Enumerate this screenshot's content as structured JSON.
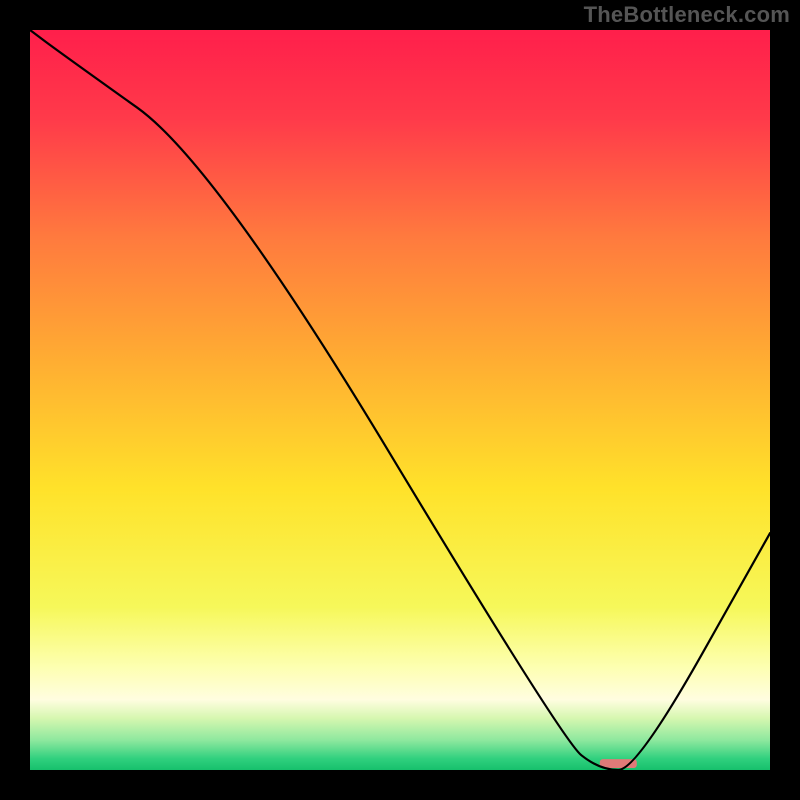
{
  "watermark": "TheBottleneck.com",
  "chart_data": {
    "type": "line",
    "title": "",
    "xlabel": "",
    "ylabel": "",
    "xlim": [
      0,
      100
    ],
    "ylim": [
      0,
      100
    ],
    "x": [
      0,
      4,
      25,
      72,
      77,
      82,
      100
    ],
    "values": [
      100,
      97,
      82,
      4,
      0,
      0,
      32
    ],
    "marker": {
      "x_start": 77,
      "x_end": 82,
      "color": "#e07a78",
      "thickness_pct": 1.2
    },
    "background_gradient": {
      "stops": [
        {
          "offset": 0.0,
          "color": "#ff1f4b"
        },
        {
          "offset": 0.12,
          "color": "#ff3a4a"
        },
        {
          "offset": 0.28,
          "color": "#ff7a3e"
        },
        {
          "offset": 0.45,
          "color": "#ffae32"
        },
        {
          "offset": 0.62,
          "color": "#ffe22a"
        },
        {
          "offset": 0.78,
          "color": "#f6f85a"
        },
        {
          "offset": 0.86,
          "color": "#fdffb0"
        },
        {
          "offset": 0.905,
          "color": "#fffde0"
        },
        {
          "offset": 0.93,
          "color": "#d6f7b0"
        },
        {
          "offset": 0.96,
          "color": "#8de89e"
        },
        {
          "offset": 0.985,
          "color": "#2fd07e"
        },
        {
          "offset": 1.0,
          "color": "#17c06c"
        }
      ]
    }
  }
}
